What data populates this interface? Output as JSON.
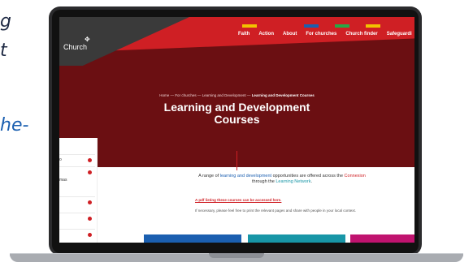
{
  "background": {
    "line1": "g",
    "line2": "t",
    "line3": "he-"
  },
  "site": {
    "logo_text": "Church",
    "logo_mark": "✥",
    "nav": [
      "Faith",
      "Action",
      "About",
      "For churches",
      "Church finder",
      "Safeguardi"
    ],
    "breadcrumb": {
      "home": "Home",
      "sep": "—",
      "for_churches": "For churches",
      "learning": "Learning and Development",
      "current": "Learning and Development Courses"
    },
    "title_line1": "Learning and Development",
    "title_line2": "Courses",
    "sidebar_items": [
      "o",
      "",
      "mas",
      "",
      "",
      ""
    ],
    "intro": {
      "part1": "A range of ",
      "link1": "learning and development",
      "part2": " opportunities are offered across the ",
      "link2": "Connexion",
      "part3": " through the ",
      "link3": "Learning Network",
      "part4": "."
    },
    "pdf_link": "A pdf listing these courses can be accessed here.",
    "note": "If necessary, please feel free to print the relevant pages and share with people in your local context.",
    "colors": {
      "hero": "#6b0f12",
      "red": "#cf1f24",
      "blue": "#1b5fb0",
      "teal": "#1896a7",
      "magenta": "#c0136f"
    }
  }
}
